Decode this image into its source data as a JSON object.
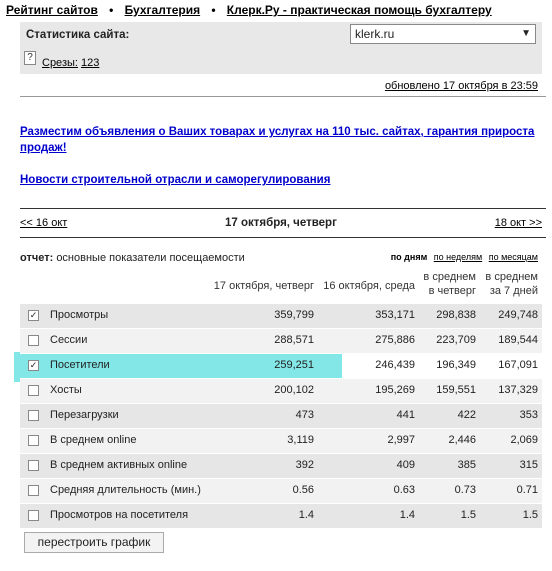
{
  "breadcrumb": {
    "items": [
      "Рейтинг сайтов",
      "Бухгалтерия",
      "Клерк.Ру - практическая помощь бухгалтеру"
    ],
    "separator": "•"
  },
  "panel": {
    "stats_label": "Статистика сайта:",
    "site_select": "klerk.ru",
    "cuts_label": "Срезы:",
    "cuts_count": "123"
  },
  "updated": "обновлено 17 октября в 23:59",
  "links": {
    "ad": "Разместим объявления о Ваших товарах и услугах на 110 тыс. сайтах, гарантия прироста продаж!",
    "news": "Новости строительной отрасли и саморегулирования"
  },
  "day_nav": {
    "prev": "<< 16 окт",
    "current": "17 октября, четверг",
    "next": "18 окт >>"
  },
  "report": {
    "label": "отчет:",
    "title": "основные показатели посещаемости",
    "periods": [
      "по дням",
      "по неделям",
      "по месяцам"
    ]
  },
  "table": {
    "headers": [
      "17 октября, четверг",
      "16 октября, среда",
      "в среднем в четверг",
      "в среднем за 7 дней"
    ],
    "rows": [
      {
        "label": "Просмотры",
        "checked": true,
        "values": [
          "359,799",
          "353,171",
          "298,838",
          "249,748"
        ]
      },
      {
        "label": "Сессии",
        "checked": false,
        "values": [
          "288,571",
          "275,886",
          "223,709",
          "189,544"
        ]
      },
      {
        "label": "Посетители",
        "checked": true,
        "values": [
          "259,251",
          "246,439",
          "196,349",
          "167,091"
        ]
      },
      {
        "label": "Хосты",
        "checked": false,
        "values": [
          "200,102",
          "195,269",
          "159,551",
          "137,329"
        ]
      },
      {
        "label": "Перезагрузки",
        "checked": false,
        "values": [
          "473",
          "441",
          "422",
          "353"
        ]
      },
      {
        "label": "В среднем online",
        "checked": false,
        "values": [
          "3,119",
          "2,997",
          "2,446",
          "2,069"
        ]
      },
      {
        "label": "В среднем активных online",
        "checked": false,
        "values": [
          "392",
          "409",
          "385",
          "315"
        ]
      },
      {
        "label": "Средняя длительность (мин.)",
        "checked": false,
        "values": [
          "0.56",
          "0.63",
          "0.73",
          "0.71"
        ]
      },
      {
        "label": "Просмотров на посетителя",
        "checked": false,
        "values": [
          "1.4",
          "1.4",
          "1.5",
          "1.5"
        ]
      }
    ]
  },
  "rebuild_button": "перестроить график",
  "colors": {
    "highlight": "#6fe3e3",
    "link": "#0000cc",
    "row_shade": "#e6e6e6"
  }
}
